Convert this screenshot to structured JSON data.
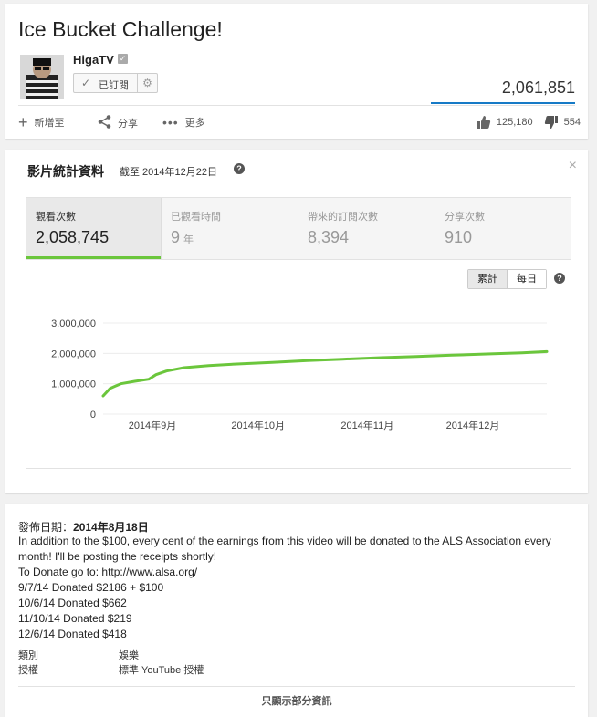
{
  "video": {
    "title": "Ice Bucket Challenge!",
    "channel": "HigaTV",
    "subscribe_label": "已訂閱",
    "view_count": "2,061,851",
    "actions": {
      "add_to": "新增至",
      "share": "分享",
      "more": "更多"
    },
    "likes": "125,180",
    "dislikes": "554"
  },
  "stats": {
    "heading": "影片統計資料",
    "as_of": "截至 2014年12月22日",
    "help_glyph": "?",
    "close_glyph": "×",
    "tabs": [
      {
        "label": "觀看次數",
        "value": "2,058,745",
        "unit": ""
      },
      {
        "label": "已觀看時間",
        "value": "9",
        "unit": "年"
      },
      {
        "label": "帶來的訂閱次數",
        "value": "8,394",
        "unit": ""
      },
      {
        "label": "分享次數",
        "value": "910",
        "unit": ""
      }
    ],
    "toggle": {
      "cumulative": "累計",
      "daily": "每日"
    }
  },
  "chart_data": {
    "type": "line",
    "title": "",
    "xlabel": "",
    "ylabel": "",
    "ylim": [
      0,
      3000000
    ],
    "y_ticks": [
      "0",
      "1,000,000",
      "2,000,000",
      "3,000,000"
    ],
    "x_tick_labels": [
      "2014年9月",
      "2014年10月",
      "2014年11月",
      "2014年12月"
    ],
    "x_tick_dates": [
      "2014-09-01",
      "2014-10-01",
      "2014-11-01",
      "2014-12-01"
    ],
    "grid": true,
    "line_color": "#6bc63c",
    "series": [
      {
        "x": [
          "2014-08-18",
          "2014-08-20",
          "2014-08-23",
          "2014-08-27",
          "2014-08-31",
          "2014-09-02",
          "2014-09-05",
          "2014-09-10",
          "2014-09-17",
          "2014-09-25",
          "2014-10-05",
          "2014-10-15",
          "2014-10-25",
          "2014-11-05",
          "2014-11-15",
          "2014-11-25",
          "2014-12-05",
          "2014-12-15",
          "2014-12-22"
        ],
        "y": [
          600000,
          850000,
          1000000,
          1080000,
          1150000,
          1300000,
          1420000,
          1530000,
          1600000,
          1650000,
          1700000,
          1760000,
          1810000,
          1860000,
          1900000,
          1940000,
          1980000,
          2020000,
          2058745
        ]
      }
    ]
  },
  "description": {
    "published_label": "發佈日期：",
    "published_date": "2014年8月18日",
    "lines": [
      "In addition to the $100, every cent of the earnings from this video will be donated to the ALS Association every month! I'll be posting the receipts shortly!",
      "To Donate go to: http://www.alsa.org/",
      "9/7/14 Donated $2186 + $100",
      "10/6/14 Donated $662",
      "11/10/14 Donated $219",
      "12/6/14 Donated $418"
    ],
    "category_label": "類別",
    "category_value": "娛樂",
    "license_label": "授權",
    "license_value": "標準 YouTube 授權",
    "show_less": "只顯示部分資訊"
  }
}
